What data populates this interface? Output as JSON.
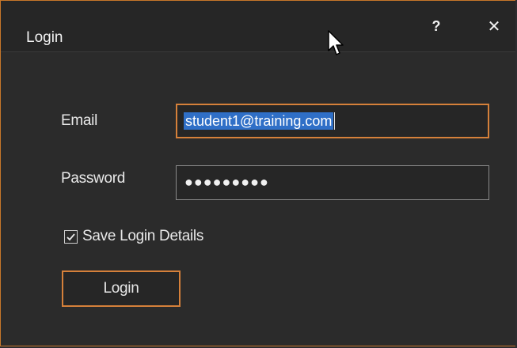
{
  "window": {
    "title": "Login",
    "help_glyph": "?",
    "close_glyph": "✕"
  },
  "form": {
    "email_label": "Email",
    "email_value": "student1@training.com",
    "password_label": "Password",
    "password_value": "●●●●●●●●●",
    "save_login_label": "Save Login Details",
    "save_login_checked": true,
    "login_button_label": "Login"
  },
  "colors": {
    "accent": "#d5803a",
    "selection": "#2f6fc7",
    "background": "#2b2b2b"
  }
}
